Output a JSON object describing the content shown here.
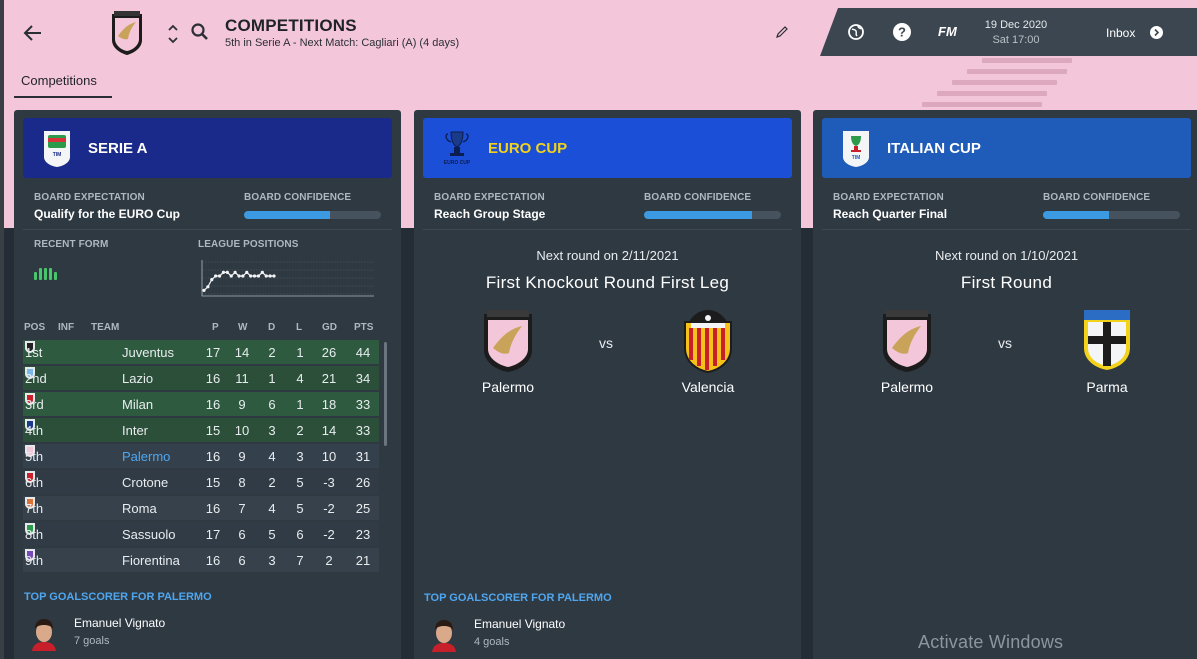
{
  "header": {
    "title": "COMPETITIONS",
    "subtitle": "5th in Serie A - Next Match: Cagliari (A) (4 days)",
    "date": "19 Dec 2020",
    "time": "Sat 17:00",
    "fm_label": "FM",
    "inbox_label": "Inbox",
    "icons": [
      "back-arrow-icon",
      "club-crest-icon",
      "up-down-chevron-icon",
      "search-icon",
      "edit-pencil-icon",
      "globe-icon",
      "help-icon",
      "inbox-arrow-icon"
    ]
  },
  "tabs": [
    {
      "label": "Competitions",
      "active": true
    }
  ],
  "serie_a": {
    "name": "SERIE A",
    "board_expectation_label": "BOARD EXPECTATION",
    "board_expectation": "Qualify for the EURO Cup",
    "board_confidence_label": "BOARD CONFIDENCE",
    "board_confidence": 0.63,
    "recent_form_label": "RECENT FORM",
    "league_positions_label": "LEAGUE POSITIONS",
    "recent_form": [
      0.5,
      1,
      1,
      1,
      0.5
    ],
    "league_positions": [
      9,
      8,
      6,
      5,
      5,
      4,
      4,
      5,
      4,
      5,
      5,
      4,
      5,
      5,
      5,
      4,
      5,
      5,
      5
    ],
    "table_headers": [
      "POS",
      "INF",
      "TEAM",
      "P",
      "W",
      "D",
      "L",
      "GD",
      "PTS"
    ],
    "table": [
      {
        "pos": "1st",
        "team": "Juventus",
        "p": "17",
        "w": "14",
        "d": "2",
        "l": "1",
        "gd": "26",
        "pts": "44"
      },
      {
        "pos": "2nd",
        "team": "Lazio",
        "p": "16",
        "w": "11",
        "d": "1",
        "l": "4",
        "gd": "21",
        "pts": "34"
      },
      {
        "pos": "3rd",
        "team": "Milan",
        "p": "16",
        "w": "9",
        "d": "6",
        "l": "1",
        "gd": "18",
        "pts": "33"
      },
      {
        "pos": "4th",
        "team": "Inter",
        "p": "15",
        "w": "10",
        "d": "3",
        "l": "2",
        "gd": "14",
        "pts": "33"
      },
      {
        "pos": "5th",
        "team": "Palermo",
        "p": "16",
        "w": "9",
        "d": "4",
        "l": "3",
        "gd": "10",
        "pts": "31"
      },
      {
        "pos": "6th",
        "team": "Crotone",
        "p": "15",
        "w": "8",
        "d": "2",
        "l": "5",
        "gd": "-3",
        "pts": "26"
      },
      {
        "pos": "7th",
        "team": "Roma",
        "p": "16",
        "w": "7",
        "d": "4",
        "l": "5",
        "gd": "-2",
        "pts": "25"
      },
      {
        "pos": "8th",
        "team": "Sassuolo",
        "p": "17",
        "w": "6",
        "d": "5",
        "l": "6",
        "gd": "-2",
        "pts": "23"
      },
      {
        "pos": "9th",
        "team": "Fiorentina",
        "p": "16",
        "w": "6",
        "d": "3",
        "l": "7",
        "gd": "2",
        "pts": "21"
      }
    ],
    "top_scorer_label": "TOP GOALSCORER FOR PALERMO",
    "top_scorer_name": "Emanuel Vignato",
    "top_scorer_goals": "7 goals"
  },
  "euro_cup": {
    "name": "EURO CUP",
    "board_expectation_label": "BOARD EXPECTATION",
    "board_expectation": "Reach Group Stage",
    "board_confidence_label": "BOARD CONFIDENCE",
    "board_confidence": 0.79,
    "next_round": "Next round on 2/11/2021",
    "round_name": "First Knockout Round First Leg",
    "home_team": "Palermo",
    "vs": "vs",
    "away_team": "Valencia",
    "top_scorer_label": "TOP GOALSCORER FOR PALERMO",
    "top_scorer_name": "Emanuel Vignato",
    "top_scorer_goals": "4 goals"
  },
  "italian_cup": {
    "name": "ITALIAN CUP",
    "board_expectation_label": "BOARD EXPECTATION",
    "board_expectation": "Reach Quarter Final",
    "board_confidence_label": "BOARD CONFIDENCE",
    "board_confidence": 0.48,
    "next_round": "Next round on 1/10/2021",
    "round_name": "First Round",
    "home_team": "Palermo",
    "vs": "vs",
    "away_team": "Parma"
  },
  "watermark": "Activate Windows",
  "colors": {
    "pink_background": "#f4c6da",
    "serie_a_banner": "#1a2a8a",
    "euro_cup_banner": "#1c4fd8",
    "euro_cup_title": "#f2d21b",
    "italian_cup_banner": "#1f5bb8",
    "confidence_fill": "#3b9ae1",
    "form_green": "#48c66b",
    "highlight_blue": "#4fa6ef"
  }
}
